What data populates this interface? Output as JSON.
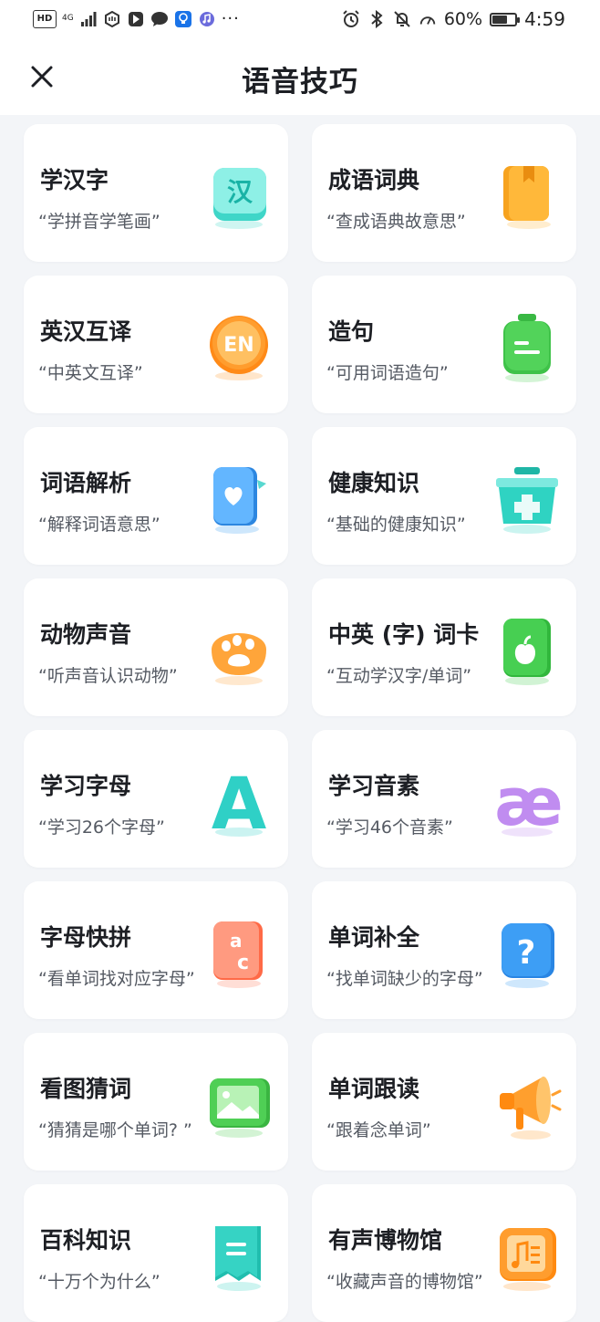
{
  "status_bar": {
    "hd": "HD",
    "network": "4G",
    "battery": "60%",
    "battery_level": 0.6,
    "time": "4:59",
    "more": "···"
  },
  "header": {
    "title": "语音技巧",
    "close_icon": "close-icon"
  },
  "features": [
    {
      "title": "学汉字",
      "subtitle": "“学拼音学笔画”",
      "icon": "hanzi-tile-icon",
      "icon_glyph": "汉",
      "color": "#3fd6c8"
    },
    {
      "title": "成语词典",
      "subtitle": "“查成语典故意思”",
      "icon": "book-icon",
      "color": "#ffb83a"
    },
    {
      "title": "英汉互译",
      "subtitle": "“中英文互译”",
      "icon": "english-coin-icon",
      "icon_glyph": "EN",
      "color": "#ff9d2e"
    },
    {
      "title": "造句",
      "subtitle": "“可用词语造句”",
      "icon": "sentence-jar-icon",
      "color": "#52d35a"
    },
    {
      "title": "词语解析",
      "subtitle": "“解释词语意思”",
      "icon": "heart-book-icon",
      "color": "#3d9ef5"
    },
    {
      "title": "健康知识",
      "subtitle": "“基础的健康知识”",
      "icon": "medical-kit-icon",
      "color": "#2fd3c2"
    },
    {
      "title": "动物声音",
      "subtitle": "“听声音认识动物”",
      "icon": "paw-icon",
      "color": "#ffa53a"
    },
    {
      "title": "中英 (字) 词卡",
      "subtitle": "“互动学汉字/单词”",
      "icon": "apple-card-icon",
      "color": "#47cf52"
    },
    {
      "title": "学习字母",
      "subtitle": "“学习26个字母”",
      "icon": "letter-a-icon",
      "icon_glyph": "A",
      "color": "#2fd0c6"
    },
    {
      "title": "学习音素",
      "subtitle": "“学习46个音素”",
      "icon": "phoneme-ae-icon",
      "icon_glyph": "æ",
      "color": "#c08cf0"
    },
    {
      "title": "字母快拼",
      "subtitle": "“看单词找对应字母”",
      "icon": "letters-tile-icon",
      "color": "#ff7a5a"
    },
    {
      "title": "单词补全",
      "subtitle": "“找单词缺少的字母”",
      "icon": "question-tile-icon",
      "icon_glyph": "?",
      "color": "#3d9ef5"
    },
    {
      "title": "看图猜词",
      "subtitle": "“猜猜是哪个单词? ”",
      "icon": "picture-icon",
      "color": "#4fcf55"
    },
    {
      "title": "单词跟读",
      "subtitle": "“跟着念单词”",
      "icon": "megaphone-icon",
      "color": "#ff9f2e"
    },
    {
      "title": "百科知识",
      "subtitle": "“十万个为什么”",
      "icon": "encyclopedia-icon",
      "color": "#36d3c4"
    },
    {
      "title": "有声博物馆",
      "subtitle": "“收藏声音的博物馆”",
      "icon": "music-museum-icon",
      "color": "#ff9d2e"
    }
  ]
}
